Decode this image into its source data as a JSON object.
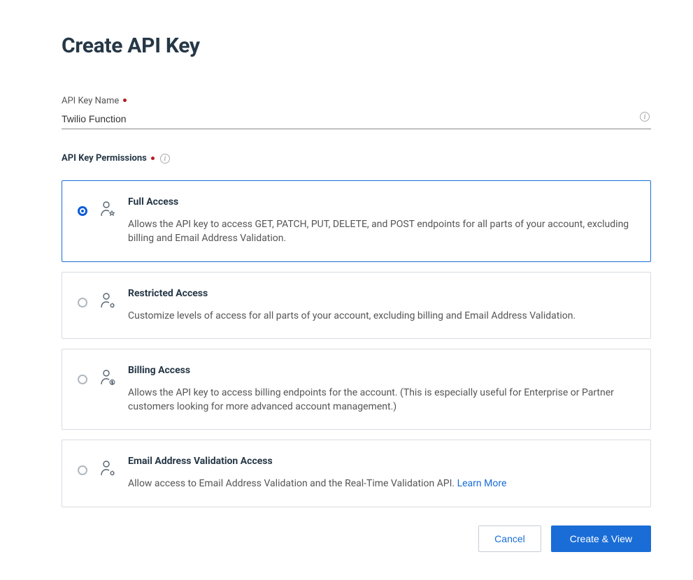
{
  "page": {
    "title": "Create API Key"
  },
  "field": {
    "name_label": "API Key Name",
    "name_value": "Twilio Function"
  },
  "permissions": {
    "section_label": "API Key Permissions",
    "options": [
      {
        "title": "Full Access",
        "desc": "Allows the API key to access GET, PATCH, PUT, DELETE, and POST endpoints for all parts of your account, excluding billing and Email Address Validation.",
        "selected": true,
        "icon": "user-star"
      },
      {
        "title": "Restricted Access",
        "desc": "Customize levels of access for all parts of your account, excluding billing and Email Address Validation.",
        "selected": false,
        "icon": "user-gear"
      },
      {
        "title": "Billing Access",
        "desc": "Allows the API key to access billing endpoints for the account. (This is especially useful for Enterprise or Partner customers looking for more advanced account management.)",
        "selected": false,
        "icon": "user-dollar"
      },
      {
        "title": "Email Address Validation Access",
        "desc_prefix": "Allow access to Email Address Validation and the Real-Time Validation API. ",
        "learn_more": "Learn More",
        "selected": false,
        "icon": "user-gear"
      }
    ]
  },
  "actions": {
    "cancel": "Cancel",
    "create": "Create & View"
  }
}
